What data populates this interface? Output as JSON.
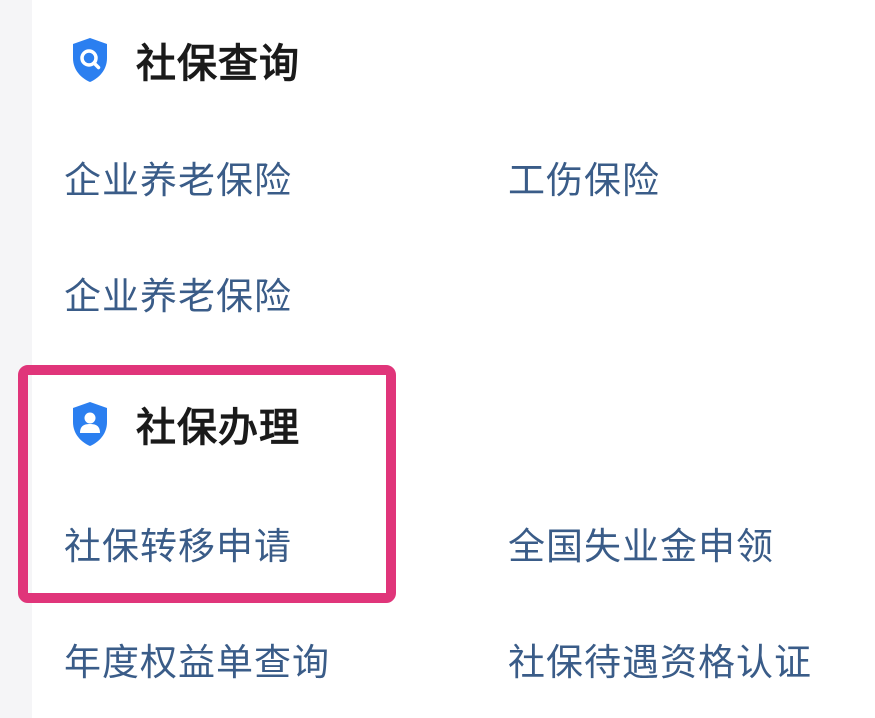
{
  "query_section": {
    "title": "社保查询",
    "icon": "search-shield-icon",
    "items": [
      {
        "label": "企业养老保险"
      },
      {
        "label": "工伤保险"
      },
      {
        "label": "企业养老保险"
      }
    ]
  },
  "handle_section": {
    "title": "社保办理",
    "icon": "user-shield-icon",
    "items": [
      {
        "label": "社保转移申请"
      },
      {
        "label": "全国失业金申领"
      },
      {
        "label": "年度权益单查询"
      },
      {
        "label": "社保待遇资格认证"
      }
    ]
  },
  "colors": {
    "link": "#3a5c88",
    "icon": "#2b7ff0",
    "highlight": "#e0357a"
  }
}
